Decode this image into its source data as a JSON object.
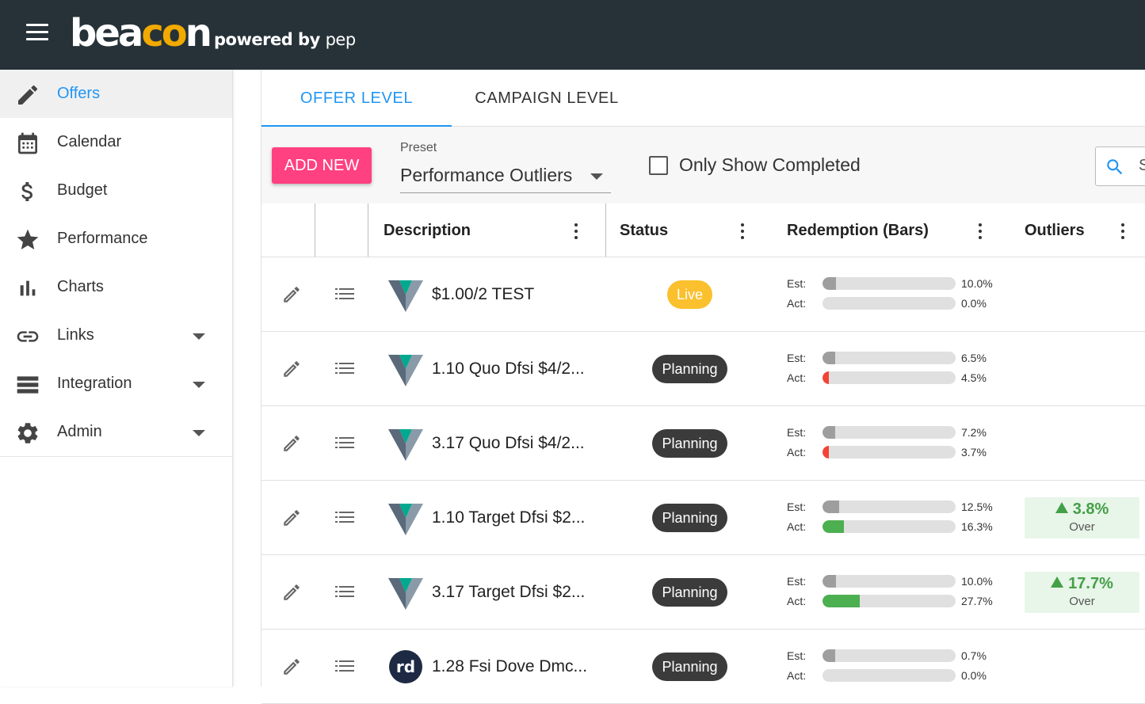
{
  "header": {
    "logo_text": "beacon",
    "powered_prefix": "powered by",
    "powered_brand": "pep"
  },
  "sidebar": {
    "items": [
      {
        "label": "Offers",
        "icon": "pencil-icon",
        "active": true
      },
      {
        "label": "Calendar",
        "icon": "calendar-icon"
      },
      {
        "label": "Budget",
        "icon": "dollar-icon"
      },
      {
        "label": "Performance",
        "icon": "star-icon"
      },
      {
        "label": "Charts",
        "icon": "bar-chart-icon"
      },
      {
        "label": "Links",
        "icon": "link-icon",
        "expandable": true
      },
      {
        "label": "Integration",
        "icon": "list-icon",
        "expandable": true
      },
      {
        "label": "Admin",
        "icon": "gear-icon",
        "expandable": true
      }
    ]
  },
  "tabs": [
    {
      "label": "OFFER LEVEL",
      "active": true
    },
    {
      "label": "CAMPAIGN LEVEL",
      "active": false
    }
  ],
  "toolbar": {
    "add_label": "ADD NEW",
    "preset_label": "Preset",
    "preset_value": "Performance Outliers",
    "only_completed_label": "Only Show Completed",
    "search_placeholder": "S"
  },
  "table": {
    "columns": [
      "Description",
      "Status",
      "Redemption (Bars)",
      "Outliers"
    ],
    "est_label": "Est:",
    "act_label": "Act:",
    "rows": [
      {
        "brand": "v-logo",
        "description": "$1.00/2 TEST",
        "status": "Live",
        "est": "10.0%",
        "act": "0.0%",
        "est_frac": 0.1,
        "act_frac": 0.0,
        "act_color": "none"
      },
      {
        "brand": "v-logo",
        "description": "1.10 Quo Dfsi $4/2...",
        "status": "Planning",
        "est": "6.5%",
        "act": "4.5%",
        "est_frac": 0.065,
        "act_frac": 0.045,
        "act_color": "#f44336"
      },
      {
        "brand": "v-logo",
        "description": "3.17 Quo Dfsi $4/2...",
        "status": "Planning",
        "est": "7.2%",
        "act": "3.7%",
        "est_frac": 0.072,
        "act_frac": 0.037,
        "act_color": "#f44336"
      },
      {
        "brand": "v-logo",
        "description": "1.10 Target Dfsi $2...",
        "status": "Planning",
        "est": "12.5%",
        "act": "16.3%",
        "est_frac": 0.125,
        "act_frac": 0.163,
        "act_color": "#4caf50",
        "outlier_pct": "3.8%",
        "outlier_label": "Over"
      },
      {
        "brand": "v-logo",
        "description": "3.17 Target Dfsi $2...",
        "status": "Planning",
        "est": "10.0%",
        "act": "27.7%",
        "est_frac": 0.1,
        "act_frac": 0.277,
        "act_color": "#4caf50",
        "outlier_pct": "17.7%",
        "outlier_label": "Over"
      },
      {
        "brand": "rd-logo",
        "description": "1.28 Fsi Dove Dmc...",
        "status": "Planning",
        "est": "0.7%",
        "act": "0.0%",
        "est_frac": 0.007,
        "act_frac": 0.0,
        "act_color": "none"
      }
    ]
  },
  "colors": {
    "header_bg": "#263238",
    "accent": "#2196f3",
    "add_button": "#ff4081",
    "live": "#fbc02d",
    "planning": "#3b3b3b",
    "over": "#43a047"
  }
}
